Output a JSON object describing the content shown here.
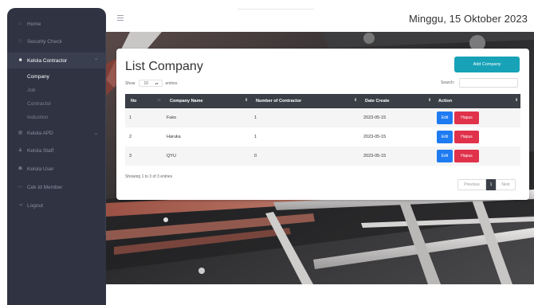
{
  "header": {
    "date": "Minggu, 15 Oktober 2023"
  },
  "sidebar": {
    "items": [
      {
        "label": "Home",
        "icon": "home-icon"
      },
      {
        "label": "Security Check",
        "icon": "shield-icon"
      },
      {
        "label": "Kelola Contractor",
        "icon": "list-icon"
      },
      {
        "label": "Kelola APD",
        "icon": "grid-icon"
      },
      {
        "label": "Kelola Staff",
        "icon": "person-icon"
      },
      {
        "label": "Kelola User",
        "icon": "users-icon"
      },
      {
        "label": "Cek Id Member",
        "icon": "card-icon"
      },
      {
        "label": "Logout",
        "icon": "logout-icon"
      }
    ],
    "subitems": [
      {
        "label": "Company"
      },
      {
        "label": "Job"
      },
      {
        "label": "Contractor"
      },
      {
        "label": "Induction"
      }
    ]
  },
  "card": {
    "title": "List Company",
    "add_button": "Add Company",
    "show_label": "Show",
    "entries_value": "10",
    "entries_label": "entries",
    "search_label": "Search:",
    "columns": [
      "No",
      "Company Name",
      "Number of Contractor",
      "Date Create",
      "Action"
    ],
    "rows": [
      {
        "no": "1",
        "name": "Fuko",
        "contractors": "1",
        "date": "2023-05-15"
      },
      {
        "no": "2",
        "name": "Haruka",
        "contractors": "1",
        "date": "2023-05-15"
      },
      {
        "no": "3",
        "name": "QYU",
        "contractors": "0",
        "date": "2023-05-15"
      }
    ],
    "edit_label": "Edit",
    "delete_label": "Hapus",
    "showing": "Showing 1 to 3 of 3 entries",
    "pagination": {
      "previous": "Previous",
      "page": "1",
      "next": "Next"
    }
  },
  "colors": {
    "sidebar_bg": "#2f3342",
    "table_header": "#3a3f47",
    "add_button": "#17a2b8",
    "edit_button": "#1e7bf2",
    "delete_button": "#e0324b"
  }
}
